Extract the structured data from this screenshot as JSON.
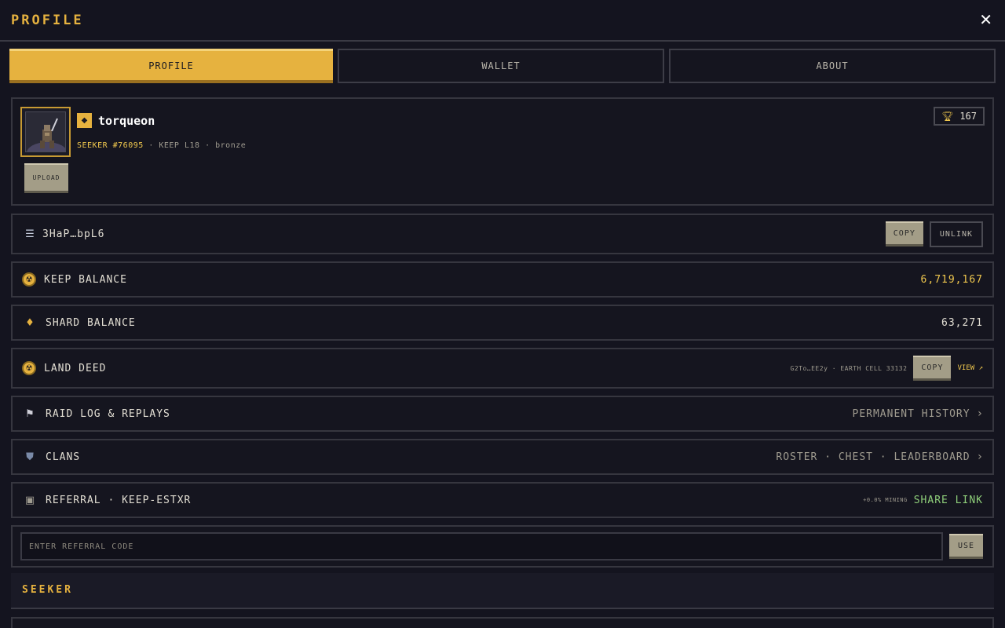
{
  "header": {
    "title": "PROFILE",
    "close_glyph": "✕"
  },
  "tabs": [
    {
      "label": "PROFILE",
      "active": true
    },
    {
      "label": "WALLET",
      "active": false
    },
    {
      "label": "ABOUT",
      "active": false
    }
  ],
  "profile": {
    "username": "torqueon",
    "rank_badge_icon": "diamond-badge-icon",
    "seeker_id": "SEEKER #76095",
    "keep_level": "KEEP L18",
    "tier": "bronze",
    "separator": "·",
    "upload_label": "UPLOAD",
    "trophy_count": "167"
  },
  "wallet": {
    "address": "3HaP…bpL6",
    "copy_label": "COPY",
    "unlink_label": "UNLINK"
  },
  "balances": {
    "keep_label": "KEEP BALANCE",
    "keep_value": "6,719,167",
    "shard_label": "SHARD BALANCE",
    "shard_value": "63,271"
  },
  "land_deed": {
    "label": "LAND DEED",
    "info": "G2To…EE2y · EARTH CELL 33132",
    "copy_label": "COPY",
    "view_label": "VIEW ↗"
  },
  "raid_log": {
    "label": "RAID LOG & REPLAYS",
    "right": "PERMANENT HISTORY",
    "chevron": "›"
  },
  "clans": {
    "label": "CLANS",
    "right": "ROSTER · CHEST · LEADERBOARD",
    "chevron": "›"
  },
  "referral": {
    "label": "REFERRAL · KEEP-ESTXR",
    "bonus": "+0.0% MINING",
    "share_label": "SHARE LINK",
    "input_placeholder": "ENTER REFERRAL CODE",
    "use_label": "USE"
  },
  "seeker_section": {
    "title": "SEEKER"
  },
  "colors": {
    "accent": "#e6b23f",
    "background": "#14141f",
    "value": "#f0c84e",
    "share": "#8fcf7a"
  }
}
